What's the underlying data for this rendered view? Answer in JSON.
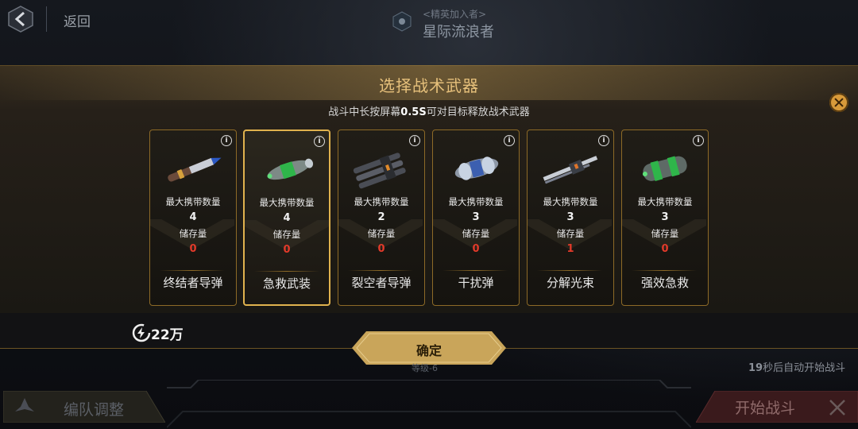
{
  "header": {
    "back_label": "返回",
    "subtitle": "<精英加入者>",
    "title": "星际流浪者"
  },
  "modal": {
    "title": "选择战术武器",
    "hint_pre": "战斗中长按屏幕",
    "hint_value": "0.5S",
    "hint_post": "可对目标释放战术武器",
    "max_label": "最大携带数量",
    "stock_label": "储存量",
    "cards": [
      {
        "name": "终结者导弹",
        "max": "4",
        "stock": "0",
        "selected": false,
        "icon": "missile-icon"
      },
      {
        "name": "急救武装",
        "max": "4",
        "stock": "0",
        "selected": true,
        "icon": "medkit-canister-icon"
      },
      {
        "name": "裂空者导弹",
        "max": "2",
        "stock": "0",
        "selected": false,
        "icon": "multi-missile-icon"
      },
      {
        "name": "干扰弹",
        "max": "3",
        "stock": "0",
        "selected": false,
        "icon": "jammer-icon"
      },
      {
        "name": "分解光束",
        "max": "3",
        "stock": "1",
        "selected": false,
        "icon": "beam-cannon-icon"
      },
      {
        "name": "强效急救",
        "max": "3",
        "stock": "0",
        "selected": false,
        "icon": "heal-canister-icon"
      }
    ]
  },
  "footer": {
    "power_value": "22万",
    "confirm_label": "确定",
    "timer_count": "19",
    "timer_text": "秒后自动开始战斗",
    "level_label": "等级-6",
    "formation_label": "编队调整",
    "start_label": "开始战斗"
  },
  "colors": {
    "gold": "#e6c07b",
    "card_border": "#8d6a27",
    "stock_red": "#e23a2a",
    "confirm_gold": "#c9a55a"
  }
}
